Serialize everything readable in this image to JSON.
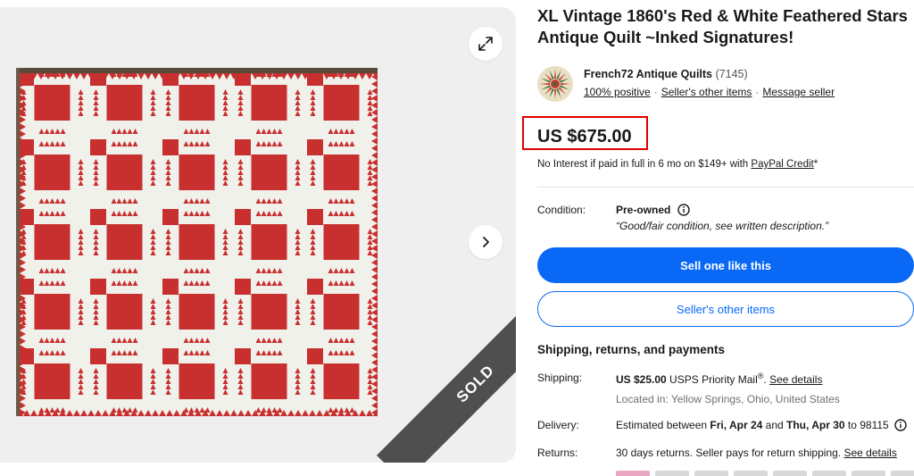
{
  "listing": {
    "title": "XL Vintage 1860's Red & White Feathered Stars Antique Quilt ~Inked Signatures!",
    "sold_label": "SOLD"
  },
  "seller": {
    "name": "French72 Antique Quilts",
    "count": "(7145)",
    "positive": "100% positive",
    "other_items": "Seller's other items",
    "message": "Message seller"
  },
  "price": {
    "amount": "US $675.00",
    "financing_prefix": "No Interest if paid in full in 6 mo on $149+ with ",
    "financing_link": "PayPal Credit",
    "financing_suffix": "*"
  },
  "condition": {
    "label": "Condition:",
    "value": "Pre-owned",
    "description": "“Good/fair condition, see written description.”"
  },
  "buttons": {
    "sell_one": "Sell one like this",
    "sellers_other_items": "Seller's other items"
  },
  "shipping": {
    "section_title": "Shipping, returns, and payments",
    "label": "Shipping:",
    "cost": "US $25.00",
    "service": " USPS Priority Mail",
    "reg": "®",
    "sep": ". ",
    "details_link": "See details",
    "location": "Located in: Yellow Springs, Ohio, United States"
  },
  "delivery": {
    "label": "Delivery:",
    "prefix": "Estimated between ",
    "start": "Fri, Apr 24",
    "mid": " and ",
    "end": "Thu, Apr 30",
    "suffix": " to 98115"
  },
  "returns": {
    "label": "Returns:",
    "text": "30 days returns. Seller pays for return shipping. ",
    "details_link": "See details"
  },
  "colors": {
    "accent": "#0968f6",
    "price_highlight": "#e00000",
    "quilt_red": "#c8302f",
    "quilt_white": "#f1f1ec"
  },
  "icons": [
    "expand-icon",
    "chevron-right-icon",
    "info-icon",
    "seller-logo"
  ]
}
